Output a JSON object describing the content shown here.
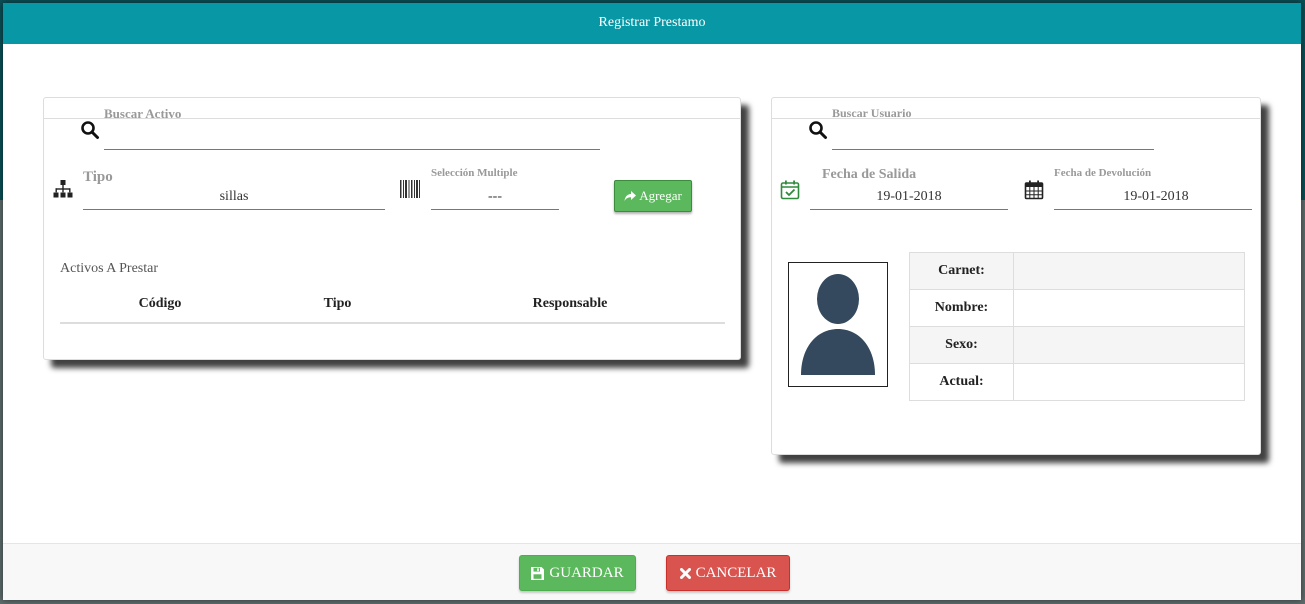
{
  "modal": {
    "title": "Registrar Prestamo"
  },
  "activo": {
    "search_label": "Buscar Activo",
    "search_value": "",
    "tipo_label": "Tipo",
    "tipo_value": "sillas",
    "seleccion_label": "Selección Multiple",
    "seleccion_value": "---",
    "agregar_label": "Agregar",
    "list_title": "Activos A Prestar",
    "columns": [
      "Código",
      "Tipo",
      "Responsable"
    ]
  },
  "usuario": {
    "search_label": "Buscar Usuario",
    "search_value": "",
    "fecha_salida_label": "Fecha de Salida",
    "fecha_salida_value": "19-01-2018",
    "fecha_devolucion_label": "Fecha de Devolución",
    "fecha_devolucion_value": "19-01-2018",
    "info_rows": [
      {
        "label": "Carnet:",
        "value": ""
      },
      {
        "label": "Nombre:",
        "value": ""
      },
      {
        "label": "Sexo:",
        "value": ""
      },
      {
        "label": "Actual:",
        "value": ""
      }
    ]
  },
  "footer": {
    "guardar_label": "GUARDAR",
    "cancelar_label": "CANCELAR"
  },
  "colors": {
    "header": "#0897a4",
    "success": "#5cb85c",
    "danger": "#d9534f",
    "avatar": "#34495e"
  },
  "icons": [
    "search-icon",
    "sitemap-icon",
    "barcode-icon",
    "share-icon",
    "calendar-check-icon",
    "calendar-icon",
    "save-icon",
    "close-icon",
    "user-avatar-icon"
  ]
}
